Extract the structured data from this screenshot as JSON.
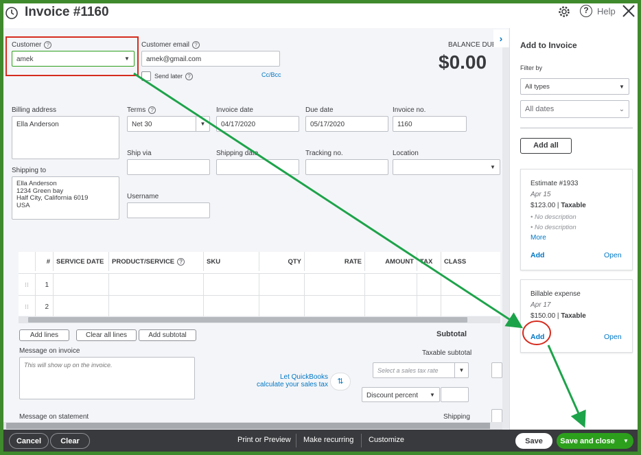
{
  "header": {
    "title": "Invoice #1160",
    "help_label": "Help"
  },
  "customer": {
    "label": "Customer",
    "value": "amek"
  },
  "customer_email": {
    "label": "Customer email",
    "value": "amek@gmail.com",
    "send_later": "Send later",
    "cc_bcc": "Cc/Bcc"
  },
  "balance": {
    "label": "BALANCE DUE",
    "value": "$0.00"
  },
  "billing": {
    "label": "Billing address",
    "value": "Ella Anderson"
  },
  "shipping_to": {
    "label": "Shipping to",
    "lines": [
      "Ella Anderson",
      "1234 Green bay",
      "Half City, California  6019",
      "USA"
    ]
  },
  "terms": {
    "label": "Terms",
    "value": "Net 30"
  },
  "invoice_date": {
    "label": "Invoice date",
    "value": "04/17/2020"
  },
  "due_date": {
    "label": "Due date",
    "value": "05/17/2020"
  },
  "invoice_no": {
    "label": "Invoice no.",
    "value": "1160"
  },
  "ship_via": {
    "label": "Ship via"
  },
  "shipping_date": {
    "label": "Shipping date"
  },
  "tracking_no": {
    "label": "Tracking no."
  },
  "location": {
    "label": "Location"
  },
  "username": {
    "label": "Username"
  },
  "grid": {
    "columns": [
      "#",
      "SERVICE DATE",
      "PRODUCT/SERVICE",
      "SKU",
      "QTY",
      "RATE",
      "AMOUNT",
      "TAX",
      "CLASS"
    ],
    "rows": [
      "1",
      "2"
    ]
  },
  "line_buttons": {
    "add_lines": "Add lines",
    "clear_all": "Clear all lines",
    "add_subtotal": "Add subtotal"
  },
  "totals": {
    "subtotal": "Subtotal",
    "taxable_subtotal": "Taxable subtotal",
    "tax_rate_placeholder": "Select a sales tax rate",
    "discount": "Discount percent",
    "shipping": "Shipping",
    "qb_tax_1": "Let QuickBooks",
    "qb_tax_2": "calculate your sales tax"
  },
  "message_invoice": {
    "label": "Message on invoice",
    "placeholder": "This will show up on the invoice."
  },
  "message_statement": {
    "label": "Message on statement"
  },
  "panel": {
    "title": "Add to Invoice",
    "filter_by": "Filter by",
    "types": "All types",
    "dates": "All dates",
    "add_all": "Add all",
    "cards": [
      {
        "title": "Estimate #1933",
        "date": "Apr 15",
        "amount": "$123.00",
        "taxable": "Taxable",
        "desc": [
          "No description",
          "No description"
        ],
        "more": "More",
        "add": "Add",
        "open": "Open"
      },
      {
        "title": "Billable expense",
        "date": "Apr 17",
        "amount": "$150.00",
        "taxable": "Taxable",
        "add": "Add",
        "open": "Open"
      }
    ]
  },
  "footer": {
    "cancel": "Cancel",
    "clear": "Clear",
    "print_preview": "Print or Preview",
    "make_recurring": "Make recurring",
    "customize": "Customize",
    "save": "Save",
    "save_close": "Save and close"
  },
  "colors": {
    "accent_green": "#2ca01c",
    "link_blue": "#0077c5",
    "highlight_red": "#d52b1e",
    "arrow_green": "#1da34a",
    "footer": "#393a3d"
  }
}
